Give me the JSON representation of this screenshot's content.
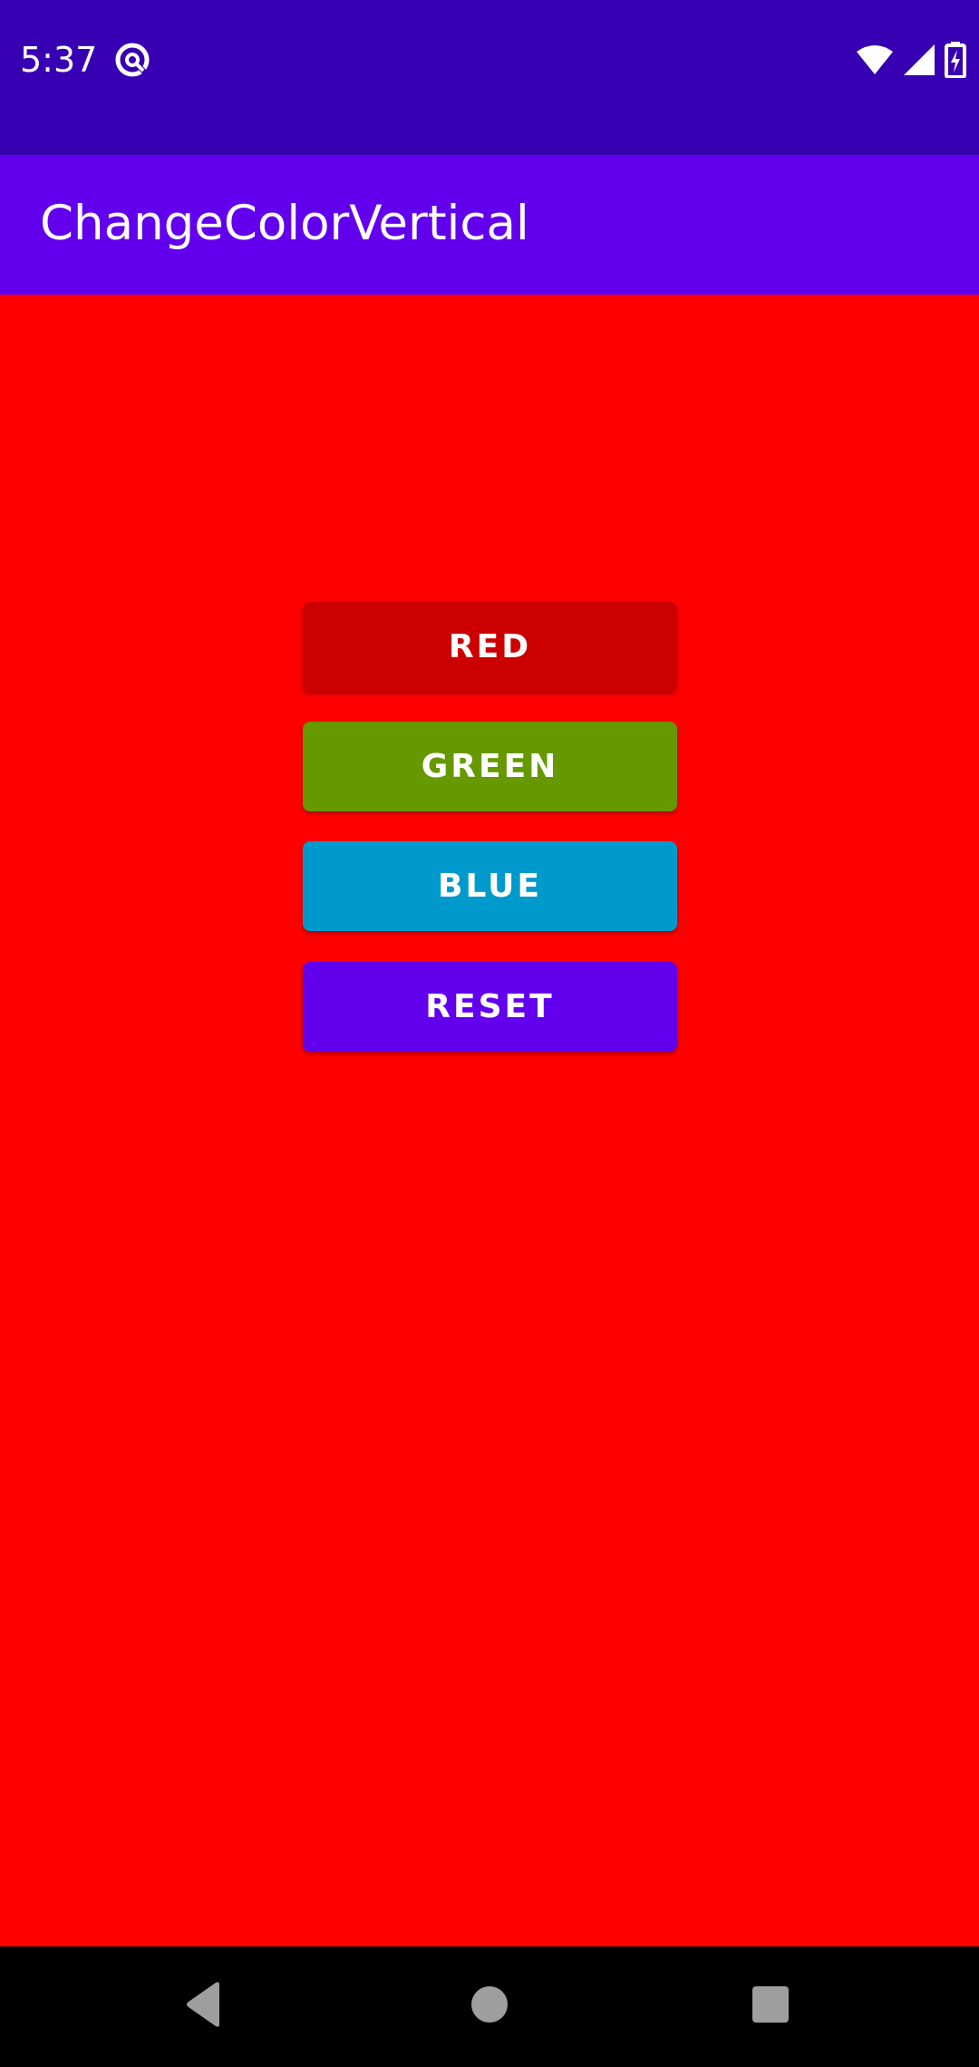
{
  "status_bar": {
    "time": "5:37",
    "app_icon": "at-sign-icon",
    "wifi_icon": "wifi-icon",
    "signal_icon": "cell-signal-icon",
    "battery_icon": "battery-charging-icon",
    "background_color": "#3700b3"
  },
  "app_bar": {
    "title": "ChangeColorVertical",
    "background_color": "#6200ee"
  },
  "content": {
    "background_color": "#ff0000"
  },
  "buttons": [
    {
      "label": "RED",
      "color": "#cc0000"
    },
    {
      "label": "GREEN",
      "color": "#669900"
    },
    {
      "label": "BLUE",
      "color": "#0099cc"
    },
    {
      "label": "RESET",
      "color": "#6200ee"
    }
  ],
  "nav_bar": {
    "back_icon": "back-triangle-icon",
    "home_icon": "home-circle-icon",
    "recents_icon": "recents-square-icon"
  }
}
